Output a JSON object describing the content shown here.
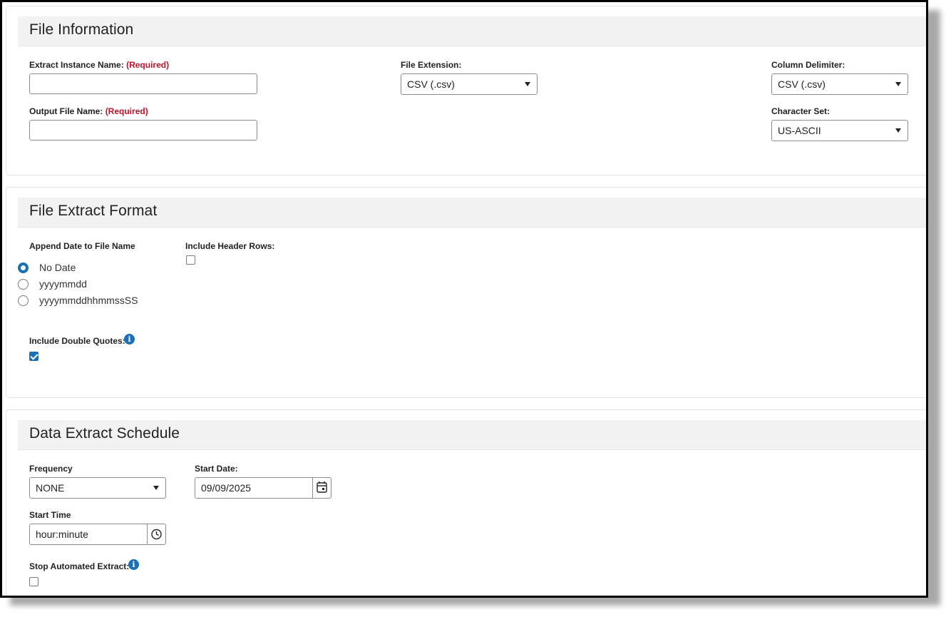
{
  "file_information": {
    "title": "File Information",
    "extract_instance_name": {
      "label": "Extract Instance Name:",
      "required": "(Required)",
      "value": ""
    },
    "output_file_name": {
      "label": "Output File Name:",
      "required": "(Required)",
      "value": ""
    },
    "file_extension": {
      "label": "File Extension:",
      "value": "CSV (.csv)"
    },
    "column_delimiter": {
      "label": "Column Delimiter:",
      "value": "CSV (.csv)"
    },
    "character_set": {
      "label": "Character Set:",
      "value": "US-ASCII"
    }
  },
  "file_extract_format": {
    "title": "File Extract Format",
    "append_date": {
      "label": "Append Date to File Name",
      "options": [
        "No Date",
        "yyyymmdd",
        "yyyymmddhhmmssSS"
      ],
      "selected": "No Date"
    },
    "include_header_rows": {
      "label": "Include Header Rows:",
      "checked": false
    },
    "include_double_quotes": {
      "label": "Include Double Quotes:",
      "checked": true,
      "icon": "info-icon"
    }
  },
  "data_extract_schedule": {
    "title": "Data Extract Schedule",
    "frequency": {
      "label": "Frequency",
      "value": "NONE"
    },
    "start_date": {
      "label": "Start Date:",
      "value": "09/09/2025",
      "icon": "calendar-icon"
    },
    "start_time": {
      "label": "Start Time",
      "value": "hour:minute",
      "icon": "clock-icon"
    },
    "stop_automated_extract": {
      "label": "Stop Automated Extract:",
      "checked": false,
      "icon": "info-icon"
    }
  },
  "colors": {
    "accent": "#1a6fb5",
    "required": "#c0132b",
    "header_bg": "#f2f2f2"
  }
}
